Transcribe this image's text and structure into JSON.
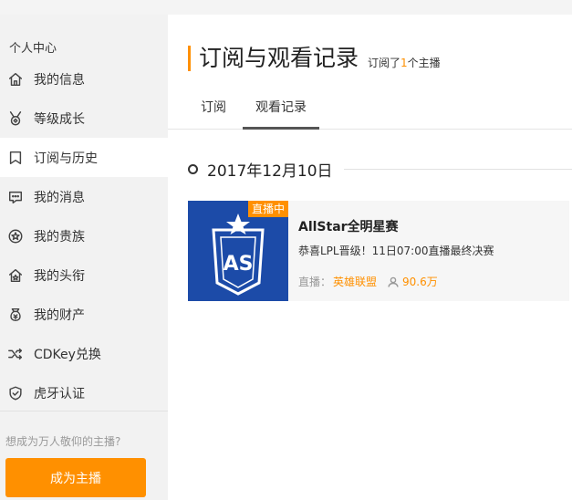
{
  "sidebar": {
    "title": "个人中心",
    "items": [
      {
        "label": "我的信息",
        "icon": "home-icon"
      },
      {
        "label": "等级成长",
        "icon": "medal-icon"
      },
      {
        "label": "订阅与历史",
        "icon": "bookmark-icon"
      },
      {
        "label": "我的消息",
        "icon": "message-icon"
      },
      {
        "label": "我的贵族",
        "icon": "star-icon"
      },
      {
        "label": "我的头衔",
        "icon": "title-house-icon"
      },
      {
        "label": "我的财产",
        "icon": "money-icon"
      },
      {
        "label": "CDKey兑换",
        "icon": "shuffle-icon"
      },
      {
        "label": "虎牙认证",
        "icon": "shield-check-icon"
      }
    ],
    "active_index": 2,
    "cta_text": "想成为万人敬仰的主播?",
    "cta_button": "成为主播"
  },
  "header": {
    "title": "订阅与观看记录",
    "sub_prefix": "订阅了",
    "sub_count": "1",
    "sub_suffix": "个主播"
  },
  "tabs": [
    {
      "label": "订阅",
      "active": false
    },
    {
      "label": "观看记录",
      "active": true
    }
  ],
  "history": {
    "date": "2017年12月10日",
    "card": {
      "badge": "直播中",
      "title": "AllStar全明星赛",
      "desc": "恭喜LPL晋级！11日07:00直播最终决赛",
      "meta_label": "直播：",
      "category": "英雄联盟",
      "viewers": "90.6万",
      "thumb_logo": "AS",
      "thumb_color": "#1c4ba8"
    }
  },
  "colors": {
    "accent": "#ff9000",
    "sidebar_bg": "#f2f2f2"
  }
}
